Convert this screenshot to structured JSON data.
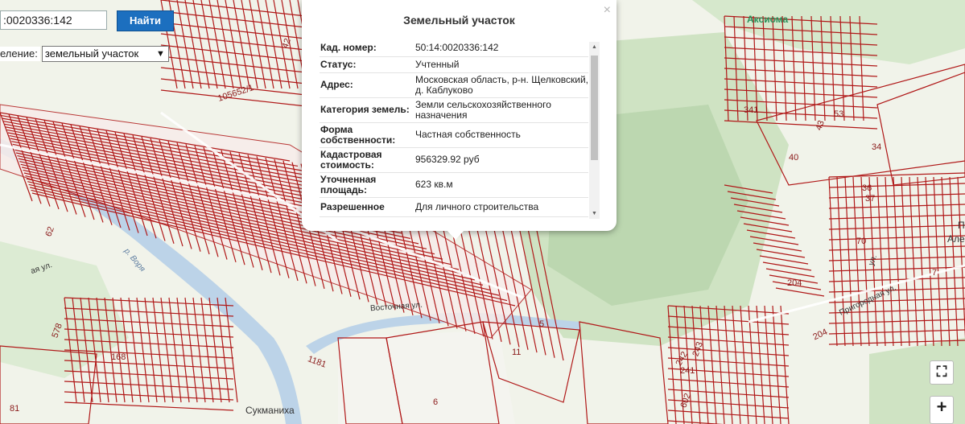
{
  "search": {
    "value": ":0020336:142",
    "button_label": "Найти"
  },
  "layer": {
    "label": "еление:",
    "selected": "земельный участок"
  },
  "popup": {
    "title": "Земельный участок",
    "close_symbol": "×",
    "rows": [
      {
        "key": "Кад. номер:",
        "value": "50:14:0020336:142"
      },
      {
        "key": "Статус:",
        "value": "Учтенный"
      },
      {
        "key": "Адрес:",
        "value": "Московская область, р-н. Щелковский, д. Каблуково"
      },
      {
        "key": "Категория земель:",
        "value": "Земли сельскохозяйственного назначения"
      },
      {
        "key": "Форма собственности:",
        "value": "Частная собственность"
      },
      {
        "key": "Кадастровая стоимость:",
        "value": "956329.92 руб"
      },
      {
        "key": "Уточненная площадь:",
        "value": "623 кв.м"
      },
      {
        "key": "Разрешенное",
        "value": "Для личного строительства"
      }
    ]
  },
  "map": {
    "labels": {
      "plot_105652": "105652/1",
      "plot_42": "42",
      "plot_62": "62",
      "plot_578": "578",
      "plot_168": "168",
      "plot_81": "81",
      "plot_6": "6",
      "plot_11": "11",
      "plot_5": "5",
      "plot_1181": "1181",
      "plot_341": "341",
      "plot_34": "34",
      "plot_40": "40",
      "plot_43": "43",
      "plot_53": "53",
      "plot_36": "36",
      "plot_37": "37",
      "plot_70": "70",
      "plot_7": "7",
      "plot_204a": "204",
      "plot_204b": "204",
      "plot_242": "242",
      "plot_241": "241",
      "plot_243": "243",
      "plot_602": "602",
      "river": "р. Воря",
      "street_vost": "Восточная ул.",
      "street_prig": "Пригородная ул.",
      "street_ul": "ул.",
      "street_left": "ая ул.",
      "village": "Сукманиха",
      "brand": "Аксиома",
      "edge_ale": "Але",
      "edge_p": "П"
    },
    "colors": {
      "parcel": "#b01818",
      "forest": "#cfe3c3",
      "forest_dark": "#bcd7b0",
      "water": "#bcd3e8",
      "field": "#f3f1e8"
    }
  },
  "controls": {
    "fullscreen_symbol": "⛶",
    "zoom_in_symbol": "+"
  }
}
